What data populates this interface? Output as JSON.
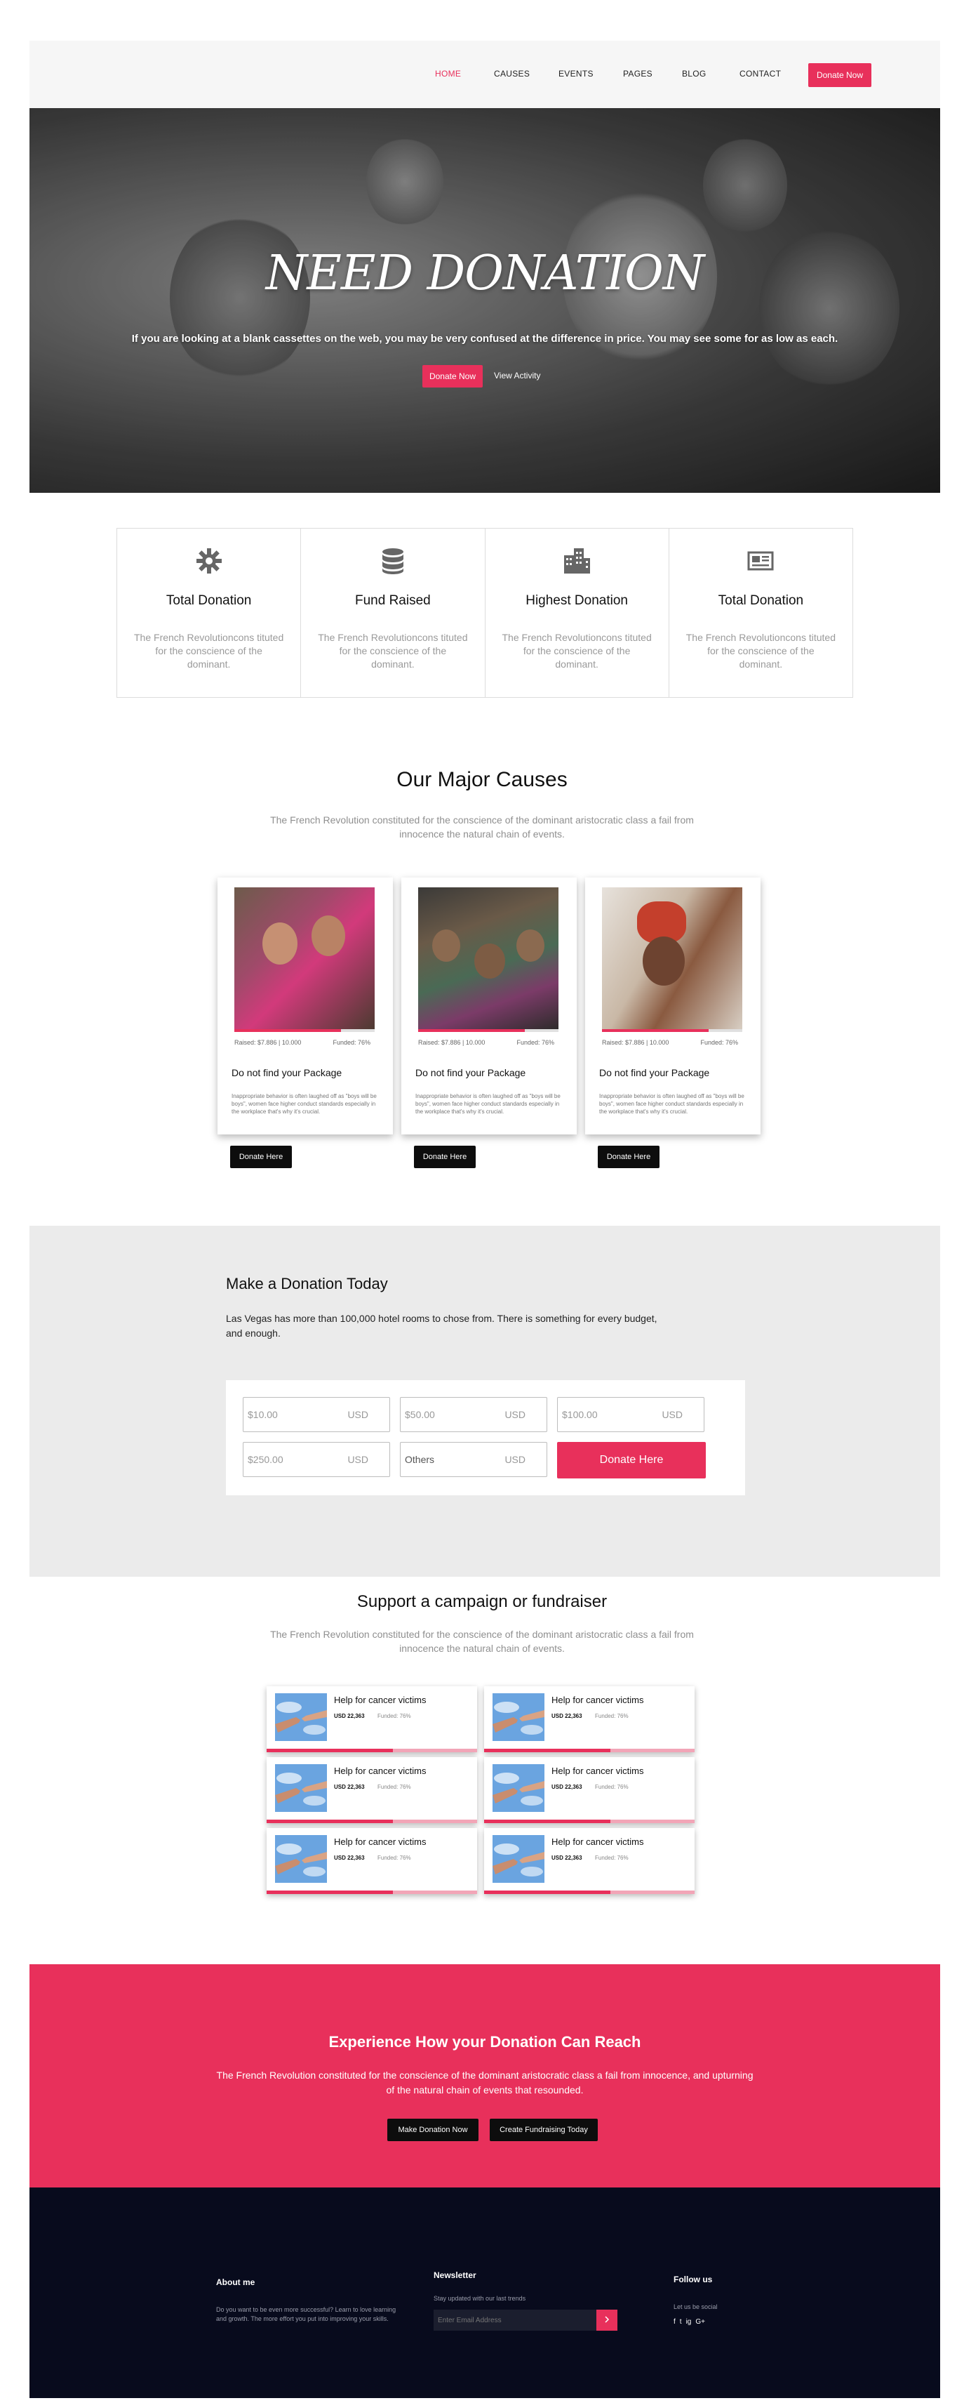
{
  "nav": {
    "items": [
      "HOME",
      "CAUSES",
      "EVENTS",
      "PAGES",
      "BLOG",
      "CONTACT"
    ],
    "donate_label": "Donate Now"
  },
  "hero": {
    "title": "NEED DONATION",
    "subtitle": "If you are looking at a blank cassettes on the web, you may be very confused at the difference in price. You may see some for as low as each.",
    "primary_label": "Donate Now",
    "secondary_label": "View Activity"
  },
  "stats": [
    {
      "icon": "gear-icon",
      "title": "Total Donation",
      "text": "The French Revolutioncons tituted for the conscience of the dominant."
    },
    {
      "icon": "database-icon",
      "title": "Fund Raised",
      "text": "The French Revolutioncons tituted for the conscience of the dominant."
    },
    {
      "icon": "building-icon",
      "title": "Highest Donation",
      "text": "The French Revolutioncons tituted for the conscience of the dominant."
    },
    {
      "icon": "newspaper-icon",
      "title": "Total Donation",
      "text": "The French Revolutioncons tituted for the conscience of the dominant."
    }
  ],
  "causes": {
    "title": "Our Major Causes",
    "desc": "The French Revolution constituted for the conscience of the dominant aristocratic class a fail from innocence the natural chain of events.",
    "cards": [
      {
        "raised": "Raised: $7.886 | 10.000",
        "funded": "Funded: 76%",
        "progress": 0.76,
        "title": "Do not find your Package",
        "text": "Inappropriate behavior is often laughed off as \"boys will be boys\", women face higher conduct standards especially in the workplace that's why it's crucial.",
        "button": "Donate Here"
      },
      {
        "raised": "Raised: $7.886 | 10.000",
        "funded": "Funded: 76%",
        "progress": 0.76,
        "title": "Do not find your Package",
        "text": "Inappropriate behavior is often laughed off as \"boys will be boys\", women face higher conduct standards especially in the workplace that's why it's crucial.",
        "button": "Donate Here"
      },
      {
        "raised": "Raised: $7.886 | 10.000",
        "funded": "Funded: 76%",
        "progress": 0.76,
        "title": "Do not find your Package",
        "text": "Inappropriate behavior is often laughed off as \"boys will be boys\", women face higher conduct standards especially in the workplace that's why it's crucial.",
        "button": "Donate Here"
      }
    ]
  },
  "donation": {
    "title": "Make a Donation Today",
    "lead": "Las Vegas has more than 100,000 hotel rooms to chose from. There is something for every budget, and enough.",
    "amounts": [
      {
        "value": "$10.00",
        "unit": "USD"
      },
      {
        "value": "$50.00",
        "unit": "USD"
      },
      {
        "value": "$100.00",
        "unit": "USD"
      },
      {
        "value": "$250.00",
        "unit": "USD"
      },
      {
        "value": "Others",
        "unit": "USD"
      }
    ],
    "button": "Donate Here"
  },
  "fundraiser": {
    "title": "Support a campaign or fundraiser",
    "desc": "The French Revolution constituted for the conscience of the dominant aristocratic class a fail from innocence the natural chain of events.",
    "items": [
      {
        "title": "Help for cancer victims",
        "amount": "USD 22,363",
        "funded": "Funded: 76%",
        "progress": 0.6
      },
      {
        "title": "Help for cancer victims",
        "amount": "USD 22,363",
        "funded": "Funded: 76%",
        "progress": 0.6
      },
      {
        "title": "Help for cancer victims",
        "amount": "USD 22,363",
        "funded": "Funded: 76%",
        "progress": 0.6
      },
      {
        "title": "Help for cancer victims",
        "amount": "USD 22,363",
        "funded": "Funded: 76%",
        "progress": 0.6
      },
      {
        "title": "Help for cancer victims",
        "amount": "USD 22,363",
        "funded": "Funded: 76%",
        "progress": 0.6
      },
      {
        "title": "Help for cancer victims",
        "amount": "USD 22,363",
        "funded": "Funded: 76%",
        "progress": 0.6
      }
    ]
  },
  "cta": {
    "title": "Experience How your Donation Can Reach",
    "text": "The French Revolution constituted for the conscience of the dominant aristocratic class a fail from innocence, and upturning of the natural chain of events that resounded.",
    "button1": "Make Donation Now",
    "button2": "Create Fundraising Today"
  },
  "footer": {
    "about_title": "About me",
    "about_text": "Do you want to be even more successful? Learn to love learning and growth. The more effort you put into improving your skills.",
    "newsletter_title": "Newsletter",
    "newsletter_text": "Stay updated with our last trends",
    "email_placeholder": "Enter Email Address",
    "follow_title": "Follow us",
    "follow_text": "Let us be social",
    "social": [
      "f",
      "t",
      "ig",
      "G+"
    ]
  },
  "colors": {
    "accent": "#e8305b",
    "dark": "#080b1d",
    "black_button": "#0d0d0d"
  }
}
